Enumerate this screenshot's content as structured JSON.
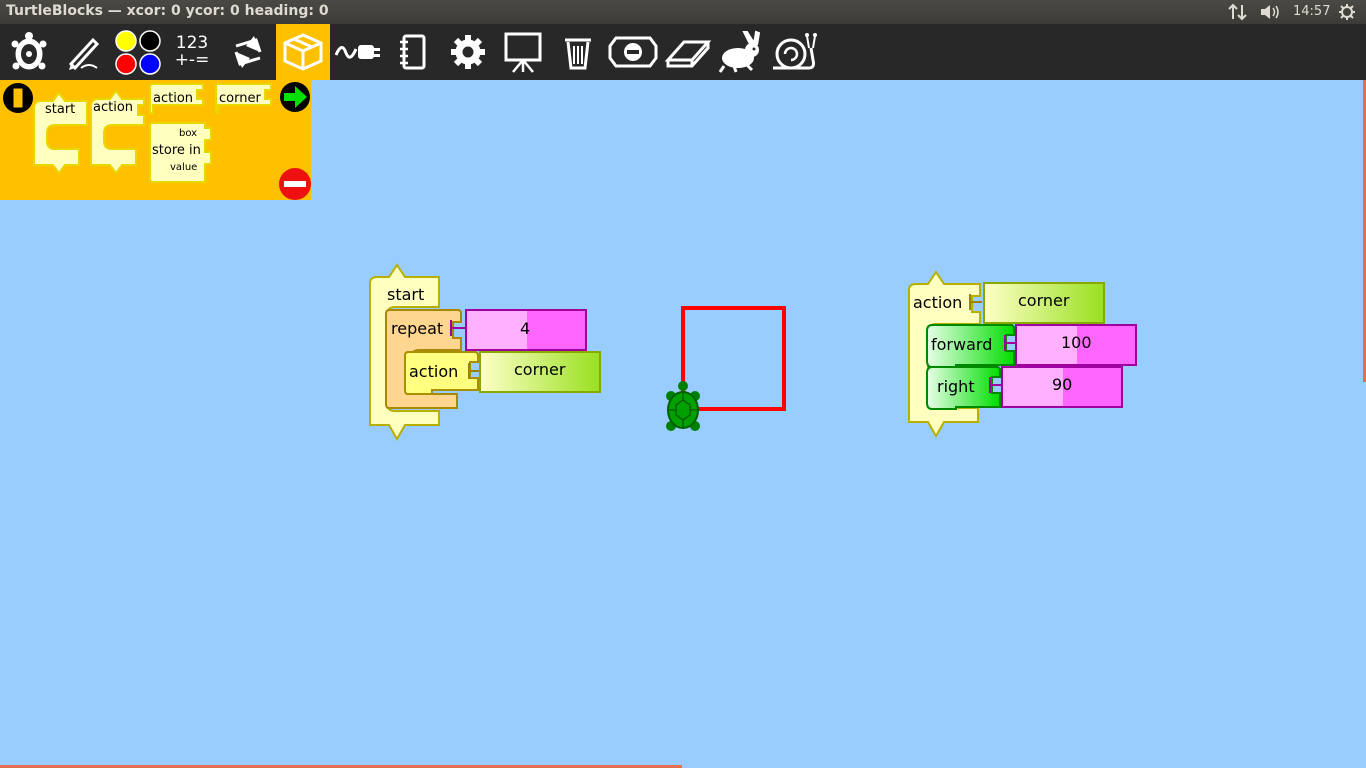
{
  "window": {
    "title": "TurtleBlocks — xcor: 0 ycor: 0 heading: 0",
    "clock": "14:57"
  },
  "toolbar": {
    "numbers_label_top": "123",
    "numbers_label_bottom": "+-=",
    "items": [
      {
        "name": "activity-icon"
      },
      {
        "name": "pen-icon"
      },
      {
        "name": "colors-icon"
      },
      {
        "name": "numbers-icon"
      },
      {
        "name": "flow-icon"
      },
      {
        "name": "blocks-icon",
        "active": true
      },
      {
        "name": "sensors-icon"
      },
      {
        "name": "extras-icon"
      },
      {
        "name": "settings-icon"
      },
      {
        "name": "presentation-icon"
      },
      {
        "name": "trash-icon"
      },
      {
        "name": "collapse-icon"
      },
      {
        "name": "eraser-icon"
      },
      {
        "name": "run-fast-icon"
      },
      {
        "name": "run-slow-icon"
      }
    ]
  },
  "palette": {
    "start": "start",
    "action": "action",
    "action_name": "action",
    "corner": "corner",
    "box": "box",
    "store_in": "store in",
    "value": "value"
  },
  "program_main": {
    "start": "start",
    "repeat": "repeat",
    "repeat_count": "4",
    "action": "action",
    "action_arg": "corner"
  },
  "program_action": {
    "action": "action",
    "name": "corner",
    "forward": "forward",
    "forward_value": "100",
    "right": "right",
    "right_value": "90"
  },
  "colors": {
    "canvas": "#99ccff",
    "toolbar": "#282828",
    "palette": "#ffc000",
    "turtle_line": "#ff0000",
    "turtle": "#008000"
  }
}
